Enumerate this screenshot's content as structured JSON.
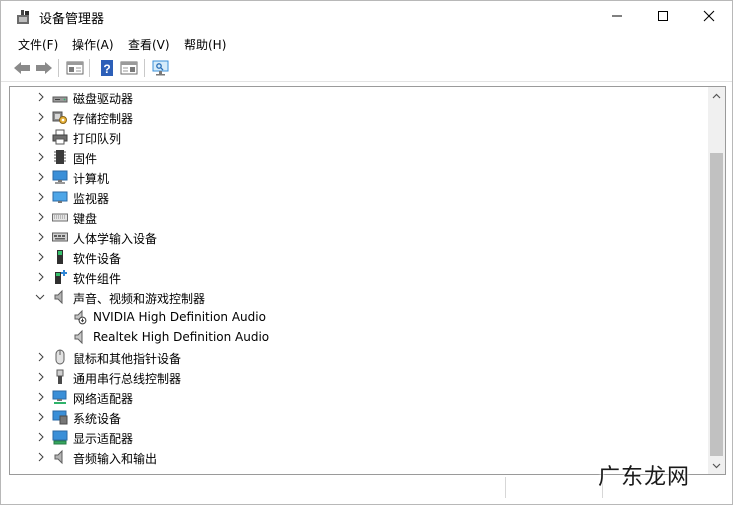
{
  "window": {
    "title": "设备管理器",
    "controls": {
      "minimize": "minimize",
      "maximize": "maximize",
      "close": "close"
    }
  },
  "menubar": {
    "items": [
      {
        "label": "文件(F)"
      },
      {
        "label": "操作(A)"
      },
      {
        "label": "查看(V)"
      },
      {
        "label": "帮助(H)"
      }
    ]
  },
  "toolbar": {
    "buttons": [
      "back-arrow-icon",
      "forward-arrow-icon",
      "properties-panel-icon",
      "help-icon",
      "show-hide-icon",
      "scan-monitor-icon"
    ]
  },
  "tree": {
    "nodes": [
      {
        "label": "磁盘驱动器",
        "icon": "disk-drive-icon",
        "expanded": false,
        "level": 0
      },
      {
        "label": "存储控制器",
        "icon": "storage-controller-icon",
        "expanded": false,
        "level": 0
      },
      {
        "label": "打印队列",
        "icon": "printer-icon",
        "expanded": false,
        "level": 0
      },
      {
        "label": "固件",
        "icon": "firmware-icon",
        "expanded": false,
        "level": 0
      },
      {
        "label": "计算机",
        "icon": "computer-icon",
        "expanded": false,
        "level": 0
      },
      {
        "label": "监视器",
        "icon": "monitor-icon",
        "expanded": false,
        "level": 0
      },
      {
        "label": "键盘",
        "icon": "keyboard-icon",
        "expanded": false,
        "level": 0
      },
      {
        "label": "人体学输入设备",
        "icon": "hid-icon",
        "expanded": false,
        "level": 0
      },
      {
        "label": "软件设备",
        "icon": "software-device-icon",
        "expanded": false,
        "level": 0
      },
      {
        "label": "软件组件",
        "icon": "software-component-icon",
        "expanded": false,
        "level": 0
      },
      {
        "label": "声音、视频和游戏控制器",
        "icon": "speaker-icon",
        "expanded": true,
        "level": 0
      },
      {
        "label": "NVIDIA High Definition Audio",
        "icon": "audio-device-warning-icon",
        "level": 1
      },
      {
        "label": "Realtek High Definition Audio",
        "icon": "audio-device-icon",
        "level": 1
      },
      {
        "label": "鼠标和其他指针设备",
        "icon": "mouse-icon",
        "expanded": false,
        "level": 0
      },
      {
        "label": "通用串行总线控制器",
        "icon": "usb-icon",
        "expanded": false,
        "level": 0
      },
      {
        "label": "网络适配器",
        "icon": "network-adapter-icon",
        "expanded": false,
        "level": 0
      },
      {
        "label": "系统设备",
        "icon": "system-device-icon",
        "expanded": false,
        "level": 0
      },
      {
        "label": "显示适配器",
        "icon": "display-adapter-icon",
        "expanded": false,
        "level": 0
      },
      {
        "label": "音频输入和输出",
        "icon": "audio-io-icon",
        "expanded": false,
        "level": 0
      }
    ]
  },
  "watermark": {
    "text": "广东龙网"
  },
  "colors": {
    "monitor_blue": "#3a8fd8",
    "thumb": "#c1c1c1",
    "chrome_bg": "#f0f0f0"
  }
}
